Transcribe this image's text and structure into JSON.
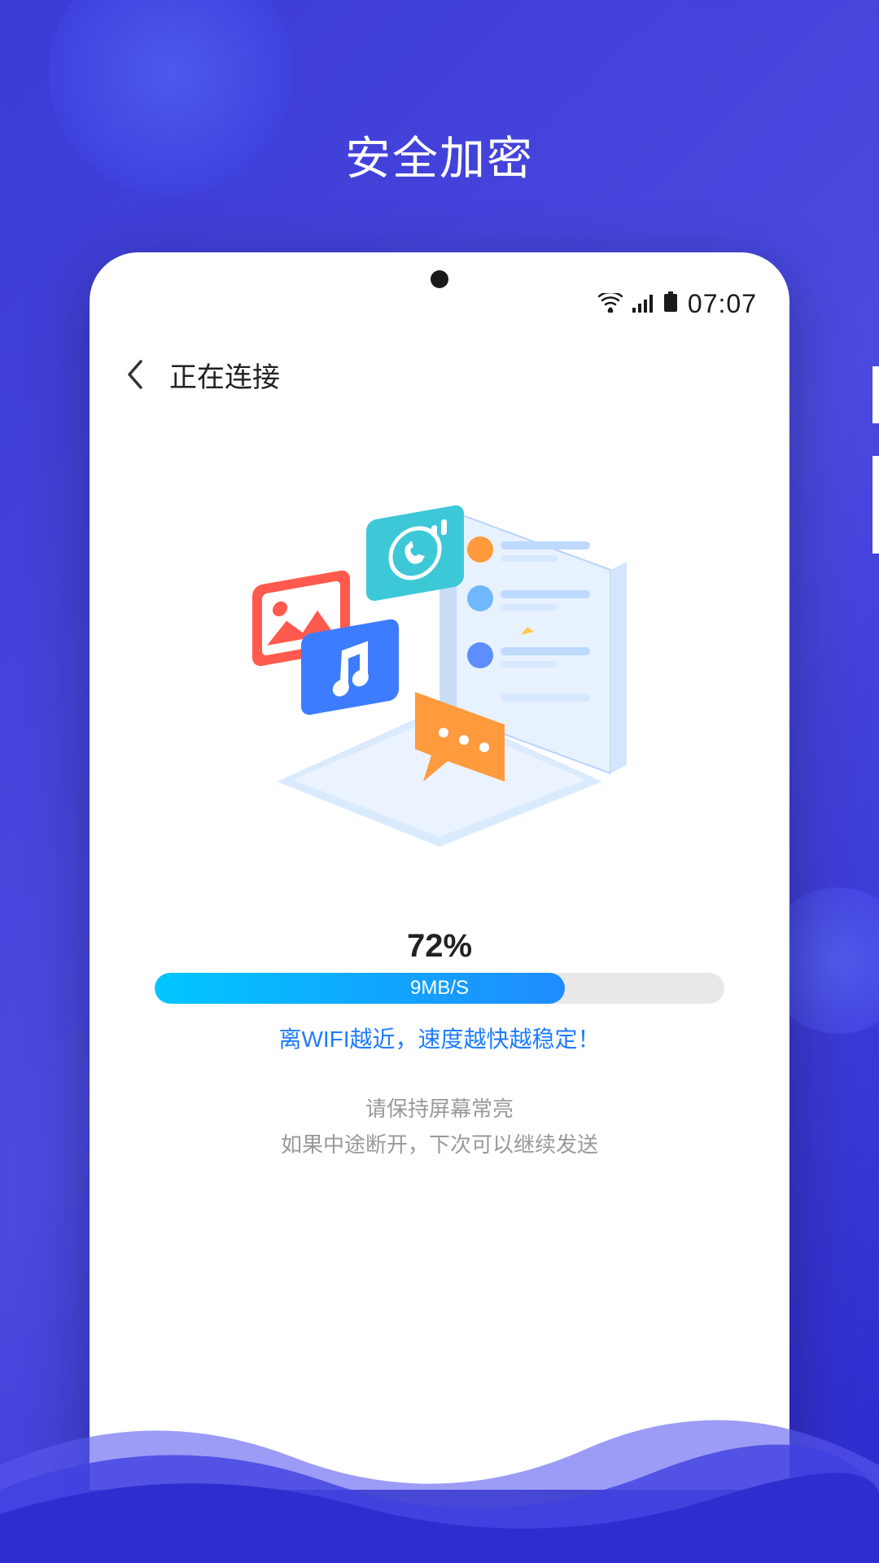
{
  "page": {
    "title": "安全加密"
  },
  "status_bar": {
    "time": "07:07"
  },
  "header": {
    "title": "正在连接"
  },
  "progress": {
    "percent_label": "72%",
    "percent_value": 72,
    "speed_label": "9MB/S",
    "tip": "离WIFI越近，速度越快越稳定！"
  },
  "hints": {
    "line1": "请保持屏幕常亮",
    "line2": "如果中途断开，下次可以继续发送"
  },
  "colors": {
    "primary_gradient_start": "#3b3bd6",
    "primary_gradient_end": "#2b2bcc",
    "progress_start": "#00c6ff",
    "progress_end": "#1e8cff",
    "link": "#1e7cff",
    "muted": "#999999"
  }
}
